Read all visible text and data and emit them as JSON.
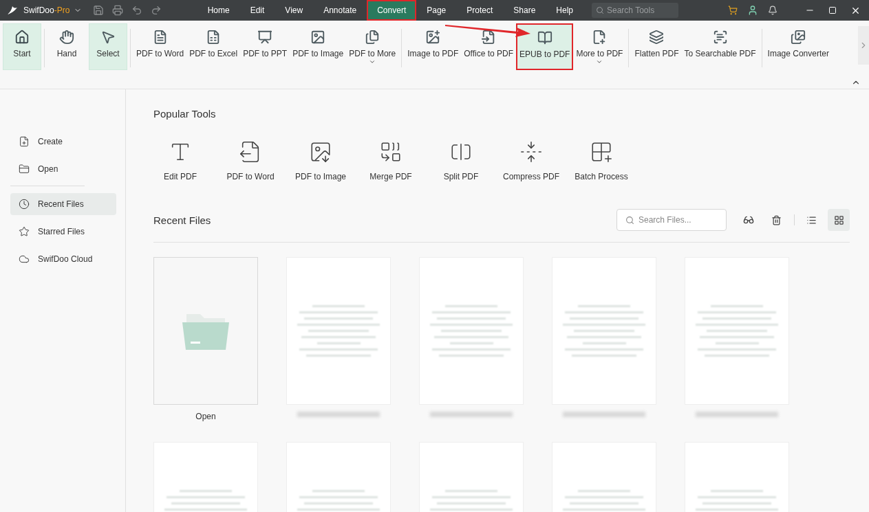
{
  "app": {
    "name": "SwifDoo",
    "edition": "-Pro"
  },
  "menu": [
    {
      "label": "Home",
      "selected": false,
      "highlighted": false
    },
    {
      "label": "Edit",
      "selected": false,
      "highlighted": false
    },
    {
      "label": "View",
      "selected": false,
      "highlighted": false
    },
    {
      "label": "Annotate",
      "selected": false,
      "highlighted": false
    },
    {
      "label": "Convert",
      "selected": true,
      "highlighted": true
    },
    {
      "label": "Page",
      "selected": false,
      "highlighted": false
    },
    {
      "label": "Protect",
      "selected": false,
      "highlighted": false
    },
    {
      "label": "Share",
      "selected": false,
      "highlighted": false
    },
    {
      "label": "Help",
      "selected": false,
      "highlighted": false
    }
  ],
  "search_tools": {
    "placeholder": "Search Tools"
  },
  "ribbon_groups": [
    [
      {
        "label": "Start",
        "selected": true,
        "dropdown": false,
        "highlighted": false
      }
    ],
    [
      {
        "label": "Hand",
        "selected": false,
        "dropdown": false,
        "highlighted": false
      },
      {
        "label": "Select",
        "selected": true,
        "dropdown": false,
        "highlighted": false
      }
    ],
    [
      {
        "label": "PDF to Word",
        "selected": false,
        "dropdown": false,
        "highlighted": false
      },
      {
        "label": "PDF to Excel",
        "selected": false,
        "dropdown": false,
        "highlighted": false
      },
      {
        "label": "PDF to PPT",
        "selected": false,
        "dropdown": false,
        "highlighted": false
      },
      {
        "label": "PDF to Image",
        "selected": false,
        "dropdown": false,
        "highlighted": false
      },
      {
        "label": "PDF to More",
        "selected": false,
        "dropdown": true,
        "highlighted": false
      }
    ],
    [
      {
        "label": "Image to PDF",
        "selected": false,
        "dropdown": false,
        "highlighted": false
      },
      {
        "label": "Office to PDF",
        "selected": false,
        "dropdown": false,
        "highlighted": false
      },
      {
        "label": "EPUB to PDF",
        "selected": true,
        "dropdown": false,
        "highlighted": true
      },
      {
        "label": "More to PDF",
        "selected": false,
        "dropdown": true,
        "highlighted": false
      }
    ],
    [
      {
        "label": "Flatten PDF",
        "selected": false,
        "dropdown": false,
        "highlighted": false
      },
      {
        "label": "To Searchable PDF",
        "selected": false,
        "dropdown": false,
        "highlighted": false
      }
    ],
    [
      {
        "label": "Image Converter",
        "selected": false,
        "dropdown": false,
        "highlighted": false
      }
    ]
  ],
  "sidebar": {
    "top_items": [
      {
        "label": "Create",
        "selected": false
      },
      {
        "label": "Open",
        "selected": false
      }
    ],
    "bottom_items": [
      {
        "label": "Recent Files",
        "selected": true
      },
      {
        "label": "Starred Files",
        "selected": false
      },
      {
        "label": "SwifDoo Cloud",
        "selected": false
      }
    ]
  },
  "popular_tools": {
    "title": "Popular Tools",
    "items": [
      "Edit PDF",
      "PDF to Word",
      "PDF to Image",
      "Merge PDF",
      "Split PDF",
      "Compress PDF",
      "Batch Process"
    ]
  },
  "recent_files": {
    "title": "Recent Files",
    "search": {
      "placeholder": "Search Files..."
    },
    "views": [
      {
        "kind": "list",
        "selected": false
      },
      {
        "kind": "grid",
        "selected": true
      }
    ],
    "files": [
      {
        "kind": "open",
        "label": "Open"
      },
      {
        "kind": "document"
      },
      {
        "kind": "document"
      },
      {
        "kind": "document"
      },
      {
        "kind": "document"
      },
      {
        "kind": "document"
      },
      {
        "kind": "document"
      },
      {
        "kind": "document"
      },
      {
        "kind": "document"
      },
      {
        "kind": "document"
      }
    ]
  }
}
